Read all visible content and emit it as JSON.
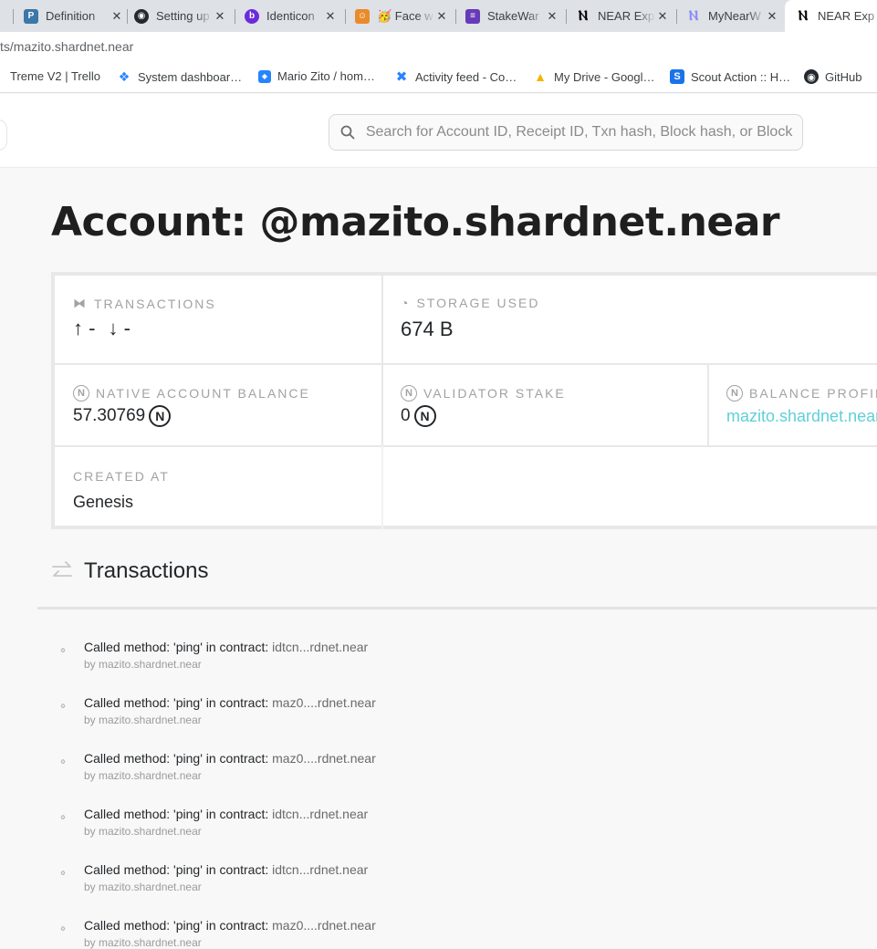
{
  "browser": {
    "tabs": [
      {
        "label": "Definition",
        "icon": "python-icon",
        "color": "#3b77a8"
      },
      {
        "label": "Setting up",
        "icon": "github-icon",
        "color": "#24292f"
      },
      {
        "label": "Identicon",
        "icon": "identicon-icon",
        "color": "#6c2bd9"
      },
      {
        "label": "🥳 Face w",
        "icon": "face-icon",
        "color": "#e98b2a"
      },
      {
        "label": "StakeWar",
        "icon": "form-icon",
        "color": "#673ab7"
      },
      {
        "label": "NEAR Exp",
        "icon": "near-icon",
        "color": "#000000"
      },
      {
        "label": "MyNearW",
        "icon": "mynear-icon",
        "color": "#8b8cf5"
      },
      {
        "label": "NEAR Exp",
        "icon": "near-icon",
        "color": "#000000"
      }
    ],
    "address": "ts/mazito.shardnet.near",
    "bookmarks": [
      {
        "label": "Treme V2 | Trello",
        "icon": "trello-icon"
      },
      {
        "label": "System dashboar…",
        "icon": "jira-icon"
      },
      {
        "label": "Mario Zito / hom…",
        "icon": "bitbucket-icon"
      },
      {
        "label": "Activity feed - Co…",
        "icon": "confluence-icon"
      },
      {
        "label": "My Drive - Googl…",
        "icon": "drive-icon"
      },
      {
        "label": "Scout Action :: H…",
        "icon": "scout-icon"
      },
      {
        "label": "GitHub",
        "icon": "github-icon"
      }
    ]
  },
  "header": {
    "search_placeholder": "Search for Account ID, Receipt ID, Txn hash, Block hash, or Block"
  },
  "account": {
    "title": "Account: @mazito.shardnet.near",
    "transactions": {
      "label": "Transactions",
      "out": "↑ -",
      "in": "↓ -"
    },
    "storage": {
      "label": "Storage Used",
      "value": "674 B"
    },
    "balance": {
      "label": "Native Account Balance",
      "value": "57.30769"
    },
    "stake": {
      "label": "Validator Stake",
      "value": "0"
    },
    "profile": {
      "label": "Balance Profile",
      "value": "mazito.shardnet.near"
    },
    "created": {
      "label": "Created At",
      "value": "Genesis"
    }
  },
  "tx_section": {
    "title": "Transactions",
    "items": [
      {
        "text": "Called method: 'ping' in contract:",
        "contract": "idtcn...rdnet.near",
        "by": "by mazito.shardnet.near"
      },
      {
        "text": "Called method: 'ping' in contract:",
        "contract": "maz0....rdnet.near",
        "by": "by mazito.shardnet.near"
      },
      {
        "text": "Called method: 'ping' in contract:",
        "contract": "maz0....rdnet.near",
        "by": "by mazito.shardnet.near"
      },
      {
        "text": "Called method: 'ping' in contract:",
        "contract": "idtcn...rdnet.near",
        "by": "by mazito.shardnet.near"
      },
      {
        "text": "Called method: 'ping' in contract:",
        "contract": "idtcn...rdnet.near",
        "by": "by mazito.shardnet.near"
      },
      {
        "text": "Called method: 'ping' in contract:",
        "contract": "maz0....rdnet.near",
        "by": "by mazito.shardnet.near"
      }
    ]
  },
  "colors": {
    "accent_link": "#5fcfd8",
    "title": "#1f1f1f",
    "label": "#a2a2a2"
  }
}
